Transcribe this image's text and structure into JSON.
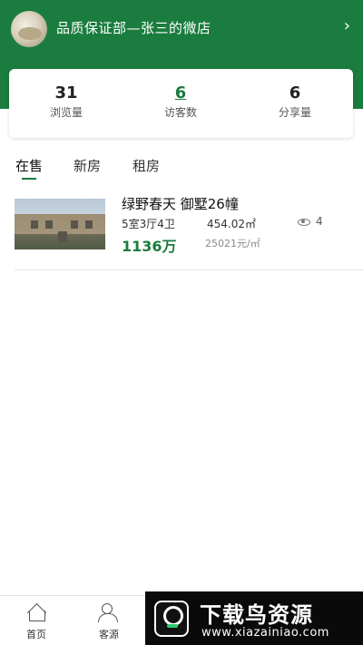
{
  "header": {
    "shop_name": "品质保证部—张三的微店",
    "chevron": "›",
    "background_color": "#1a7c3e"
  },
  "stats": [
    {
      "value": "31",
      "label": "浏览量"
    },
    {
      "value": "6",
      "label": "访客数"
    },
    {
      "value": "6",
      "label": "分享量"
    }
  ],
  "tabs": [
    {
      "label": "在售",
      "active": true
    },
    {
      "label": "新房",
      "active": false
    },
    {
      "label": "租房",
      "active": false
    }
  ],
  "listing": {
    "title": "绿野春天 御墅26幢",
    "layout": "5室3厅4卫",
    "area": "454.02㎡",
    "views": "4",
    "price": "1136万",
    "unit_price": "25021元/㎡"
  },
  "bottom_nav": [
    {
      "label": "首页",
      "icon": "home-icon"
    },
    {
      "label": "客源",
      "icon": "users-icon"
    }
  ],
  "watermark": {
    "title": "下载鸟资源",
    "url": "www.xiazainiao.com"
  }
}
